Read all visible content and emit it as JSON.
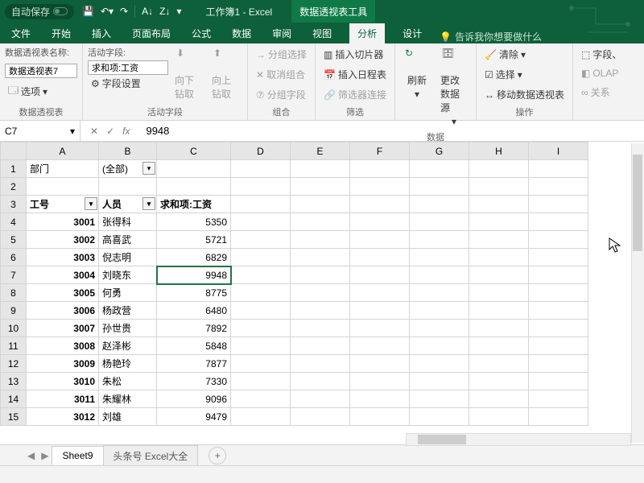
{
  "titlebar": {
    "autosave_label": "自动保存",
    "doc_title": "工作簿1 - Excel",
    "tool_title": "数据透视表工具"
  },
  "tabs": {
    "items": [
      "文件",
      "开始",
      "插入",
      "页面布局",
      "公式",
      "数据",
      "审阅",
      "视图",
      "分析",
      "设计"
    ],
    "active_index": 8,
    "tell_me": "告诉我你想要做什么"
  },
  "ribbon": {
    "pivot_name_label": "数据透视表名称:",
    "pivot_name_value": "数据透视表7",
    "options_label": "选项",
    "group_pivot": "数据透视表",
    "active_field_label": "活动字段:",
    "active_field_value": "求和项:工资",
    "field_settings": "字段设置",
    "drill_down": "向下钻取",
    "drill_up": "向上钻取",
    "group_active": "活动字段",
    "group_select": "分组选择",
    "ungroup": "取消组合",
    "group_field": "分组字段",
    "group_combine": "组合",
    "insert_slicer": "插入切片器",
    "insert_timeline": "插入日程表",
    "filter_conn": "筛选器连接",
    "group_filter": "筛选",
    "refresh": "刷新",
    "change_source": "更改数据源",
    "group_data": "数据",
    "clear": "清除",
    "select": "选择",
    "move_pivot": "移动数据透视表",
    "group_ops": "操作",
    "fields": "字段、",
    "olap": "OLAP",
    "relations": "关系"
  },
  "formula": {
    "cell_ref": "C7",
    "value": "9948",
    "fx": "fx"
  },
  "grid": {
    "cols": [
      "A",
      "B",
      "C",
      "D",
      "E",
      "F",
      "G",
      "H",
      "I"
    ],
    "a1": "部门",
    "b1": "(全部)",
    "headers": {
      "a": "工号",
      "b": "人员",
      "c": "求和项:工资"
    },
    "rows": [
      {
        "id": "3001",
        "name": "张得科",
        "val": 5350
      },
      {
        "id": "3002",
        "name": "高喜武",
        "val": 5721
      },
      {
        "id": "3003",
        "name": "倪志明",
        "val": 6829
      },
      {
        "id": "3004",
        "name": "刘晓东",
        "val": 9948
      },
      {
        "id": "3005",
        "name": "何勇",
        "val": 8775
      },
      {
        "id": "3006",
        "name": "杨政营",
        "val": 6480
      },
      {
        "id": "3007",
        "name": "孙世贵",
        "val": 7892
      },
      {
        "id": "3008",
        "name": "赵泽彬",
        "val": 5848
      },
      {
        "id": "3009",
        "name": "杨艳玲",
        "val": 7877
      },
      {
        "id": "3010",
        "name": "朱松",
        "val": 7330
      },
      {
        "id": "3011",
        "name": "朱耀林",
        "val": 9096
      },
      {
        "id": "3012",
        "name": "刘雄",
        "val": 9479
      }
    ]
  },
  "sheets": {
    "active": "Sheet9",
    "other": "头条号 Excel大全"
  }
}
